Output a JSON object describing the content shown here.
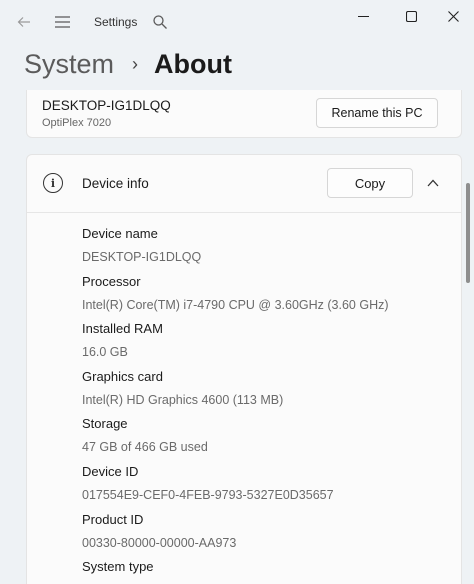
{
  "titlebar": {
    "title": "Settings",
    "icons": [
      "back-arrow-icon",
      "hamburger-menu-icon",
      "search-icon"
    ]
  },
  "breadcrumb": {
    "parent": "System",
    "separator": "›",
    "current": "About"
  },
  "pc_card": {
    "device_name": "DESKTOP-IG1DLQQ",
    "model": "OptiPlex 7020",
    "rename_label": "Rename this PC"
  },
  "device_info": {
    "title": "Device info",
    "copy_label": "Copy",
    "specs": [
      {
        "label": "Device name",
        "value": "DESKTOP-IG1DLQQ"
      },
      {
        "label": "Processor",
        "value": "Intel(R) Core(TM) i7-4790 CPU @ 3.60GHz (3.60 GHz)"
      },
      {
        "label": "Installed RAM",
        "value": "16.0 GB"
      },
      {
        "label": "Graphics card",
        "value": "Intel(R) HD Graphics 4600 (113 MB)"
      },
      {
        "label": "Storage",
        "value": "47 GB of 466 GB used"
      },
      {
        "label": "Device ID",
        "value": "017554E9-CEF0-4FEB-9793-5327E0D35657"
      },
      {
        "label": "Product ID",
        "value": "00330-80000-00000-AA973"
      },
      {
        "label": "System type",
        "value": ""
      }
    ]
  }
}
